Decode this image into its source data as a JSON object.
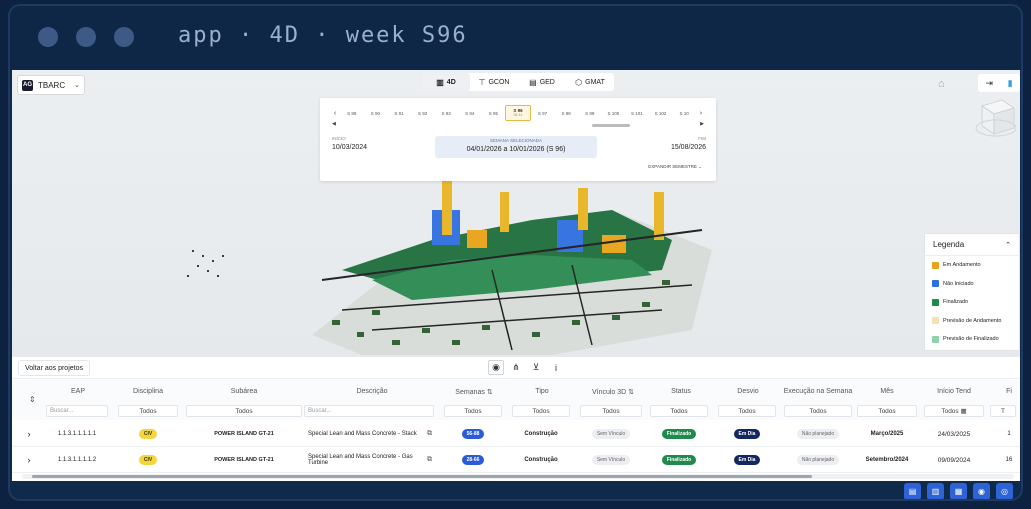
{
  "window": {
    "title": "app · 4D · week S96"
  },
  "project_selector": {
    "logo": "AG",
    "value": "TBARC"
  },
  "top_tabs": [
    {
      "label": "4D",
      "icon": "chart-icon",
      "active": true
    },
    {
      "label": "GCON",
      "icon": "crane-icon",
      "active": false
    },
    {
      "label": "GED",
      "icon": "document-icon",
      "active": false
    },
    {
      "label": "GMAT",
      "icon": "box-icon",
      "active": false
    }
  ],
  "timeline": {
    "weeks": [
      "S 89",
      "S 90",
      "S 91",
      "S 92",
      "S 93",
      "S 94",
      "S 95",
      "S 96",
      "S 97",
      "S 98",
      "S 99",
      "S 100",
      "S 101",
      "S 102",
      "S 10"
    ],
    "selected_week": "S 96",
    "selected_sub": "04-11",
    "start_label": "INÍCIO",
    "start_value": "10/03/2024",
    "selected_label": "SEMANA SELECIONADA",
    "selected_value": "04/01/2026 a 10/01/2026 (S 96)",
    "end_label": "FIM",
    "end_value": "15/08/2026",
    "expand_label": "EXPANDIR SEMESTRE"
  },
  "legend": {
    "title": "Legenda",
    "items": [
      {
        "label": "Em Andamento",
        "color": "#e8a317"
      },
      {
        "label": "Não Iniciado",
        "color": "#2f6fe0"
      },
      {
        "label": "Finalizado",
        "color": "#1f8a4c"
      },
      {
        "label": "Previsão de Andamento",
        "color": "#f6e2b0"
      },
      {
        "label": "Previsão de Finalizado",
        "color": "#8fd3a8"
      }
    ]
  },
  "toolbar": {
    "back_label": "Voltar aos projetos"
  },
  "table": {
    "columns": [
      "EAP",
      "Disciplina",
      "Subárea",
      "Descrição",
      "Semanas",
      "Tipo",
      "Vínculo 3D",
      "Status",
      "Desvio",
      "Execução na Semana",
      "Mês",
      "Início Tend",
      "Fi"
    ],
    "filters": [
      "Buscar...",
      "Todos",
      "Todos",
      "Buscar...",
      "Todos",
      "Todos",
      "Todos",
      "Todos",
      "Todos",
      "Todos",
      "Todos",
      "Todos",
      "T"
    ],
    "rows": [
      {
        "eap": "1.1.3.1.1.1.1.1",
        "disciplina": "CIV",
        "subarea": "POWER ISLAND GT-21",
        "descricao": "Special Lean and Mass Concrete - Stack",
        "semanas": "56-88",
        "tipo": "Construção",
        "vinculo": "Sem Vínculo",
        "status": "Finalizado",
        "desvio": "Em Dia",
        "execucao": "Não planejado",
        "mes": "Março/2025",
        "inicio": "24/03/2025",
        "fim": "1"
      },
      {
        "eap": "1.1.3.1.1.1.1.2",
        "disciplina": "CIV",
        "subarea": "POWER ISLAND GT-21",
        "descricao": "Special Lean and Mass Concrete - Gas Turbine",
        "semanas": "28-66",
        "tipo": "Construção",
        "vinculo": "Sem Vínculo",
        "status": "Finalizado",
        "desvio": "Em Dia",
        "execucao": "Não planejado",
        "mes": "Setembro/2024",
        "inicio": "09/09/2024",
        "fim": "16"
      }
    ]
  }
}
